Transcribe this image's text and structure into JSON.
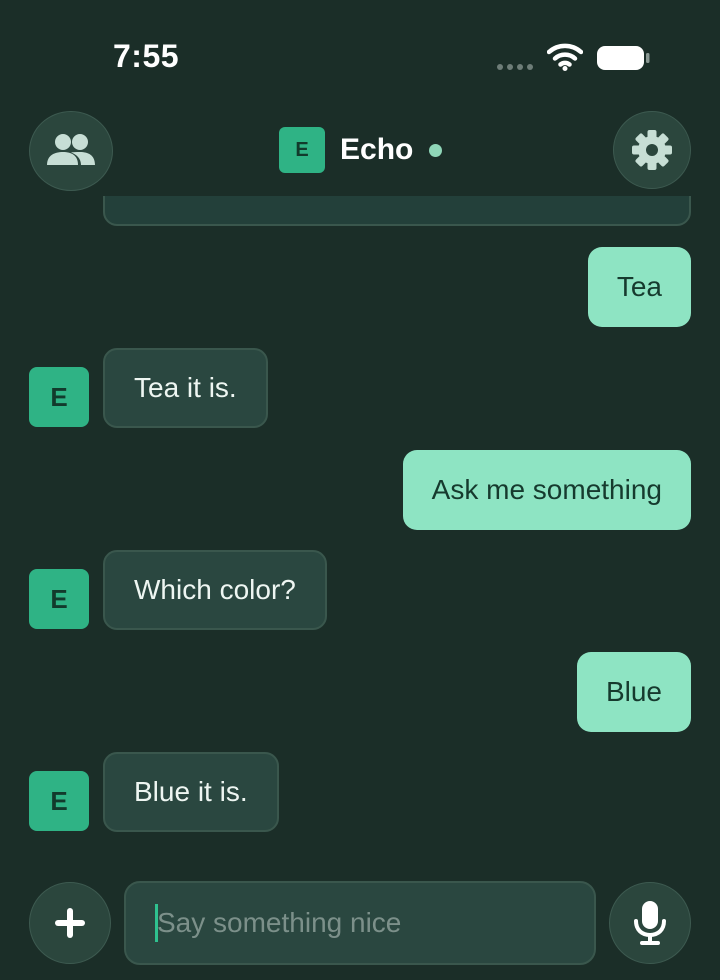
{
  "status_bar": {
    "time": "7:55"
  },
  "header": {
    "contact_initial": "E",
    "contact_name": "Echo",
    "online_status_color": "#8fd6b8",
    "left_icon": "contacts-icon",
    "right_icon": "gear-icon"
  },
  "messages": [
    {
      "sender": "me",
      "text": "Tea"
    },
    {
      "sender": "them",
      "initial": "E",
      "text": "Tea it is."
    },
    {
      "sender": "me",
      "text": "Ask me something"
    },
    {
      "sender": "them",
      "initial": "E",
      "text": "Which color?"
    },
    {
      "sender": "me",
      "text": "Blue"
    },
    {
      "sender": "them",
      "initial": "E",
      "text": "Blue it is."
    }
  ],
  "composer": {
    "placeholder": "Say something nice",
    "value": "",
    "add_icon": "plus-icon",
    "mic_icon": "microphone-icon"
  },
  "colors": {
    "background": "#1b2e28",
    "accent": "#2fb385",
    "my_bubble": "#8ee4c3",
    "their_bubble": "#2a4740"
  }
}
